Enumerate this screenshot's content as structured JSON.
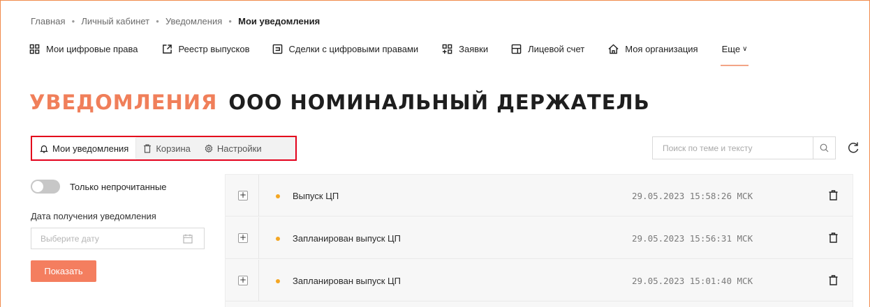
{
  "breadcrumb": [
    {
      "label": "Главная"
    },
    {
      "label": "Личный кабинет"
    },
    {
      "label": "Уведомления"
    },
    {
      "label": "Мои уведомления"
    }
  ],
  "nav": {
    "items": [
      {
        "label": "Мои цифровые права",
        "icon": "grid-icon"
      },
      {
        "label": "Реестр выпусков",
        "icon": "external-link-icon"
      },
      {
        "label": "Сделки с цифровыми правами",
        "icon": "document-icon"
      },
      {
        "label": "Заявки",
        "icon": "grid-plus-icon"
      },
      {
        "label": "Лицевой счет",
        "icon": "card-icon"
      },
      {
        "label": "Моя организация",
        "icon": "home-icon"
      }
    ],
    "more_label": "Еще"
  },
  "title": {
    "accent": "УВЕДОМЛЕНИЯ",
    "org": "ООО НОМИНАЛЬНЫЙ ДЕРЖАТЕЛЬ"
  },
  "tabs": [
    {
      "label": "Мои уведомления",
      "icon": "bell-icon",
      "active": true
    },
    {
      "label": "Корзина",
      "icon": "trash-icon",
      "active": false
    },
    {
      "label": "Настройки",
      "icon": "gear-icon",
      "active": false
    }
  ],
  "search": {
    "placeholder": "Поиск по теме и тексту"
  },
  "filters": {
    "unread_label": "Только непрочитанные",
    "unread_on": false,
    "date_label": "Дата получения уведомления",
    "date_placeholder": "Выберите дату",
    "show_button": "Показать"
  },
  "notifications": [
    {
      "subject": "Выпуск ЦП",
      "time": "29.05.2023 15:58:26 МСК"
    },
    {
      "subject": "Запланирован выпуск ЦП",
      "time": "29.05.2023 15:56:31 МСК"
    },
    {
      "subject": "Запланирован выпуск ЦП",
      "time": "29.05.2023 15:01:40 МСК"
    }
  ],
  "colors": {
    "accent": "#f07f5a",
    "button": "#f47e5f",
    "tabs_highlight": "#e3001b",
    "unread_dot": "#f4a623"
  }
}
